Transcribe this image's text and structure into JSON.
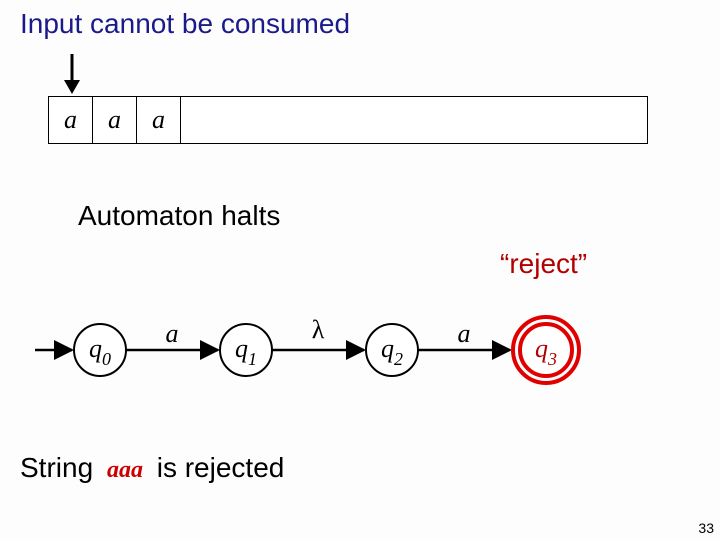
{
  "title": "Input cannot be consumed",
  "tape": {
    "cells": [
      "a",
      "a",
      "a"
    ]
  },
  "subtitle": "Automaton halts",
  "reject_label": "“reject”",
  "states": {
    "q0": "q",
    "q0_sub": "0",
    "q1": "q",
    "q1_sub": "1",
    "q2": "q",
    "q2_sub": "2",
    "q3": "q",
    "q3_sub": "3"
  },
  "transitions": {
    "t01": "a",
    "t12": "λ",
    "t23": "a"
  },
  "bottom": {
    "prefix": "String",
    "symbol": "aaa",
    "suffix": "is rejected"
  },
  "page": "33",
  "chart_data": {
    "type": "diagram",
    "automaton": {
      "states": [
        "q0",
        "q1",
        "q2",
        "q3"
      ],
      "start": "q0",
      "accepting": [
        "q3"
      ],
      "edges": [
        {
          "from": "q0",
          "to": "q1",
          "label": "a"
        },
        {
          "from": "q1",
          "to": "q2",
          "label": "λ"
        },
        {
          "from": "q2",
          "to": "q3",
          "label": "a"
        }
      ],
      "highlighted_state": "q3"
    },
    "input_tape": [
      "a",
      "a",
      "a"
    ],
    "head_position": 0,
    "result": "reject"
  }
}
